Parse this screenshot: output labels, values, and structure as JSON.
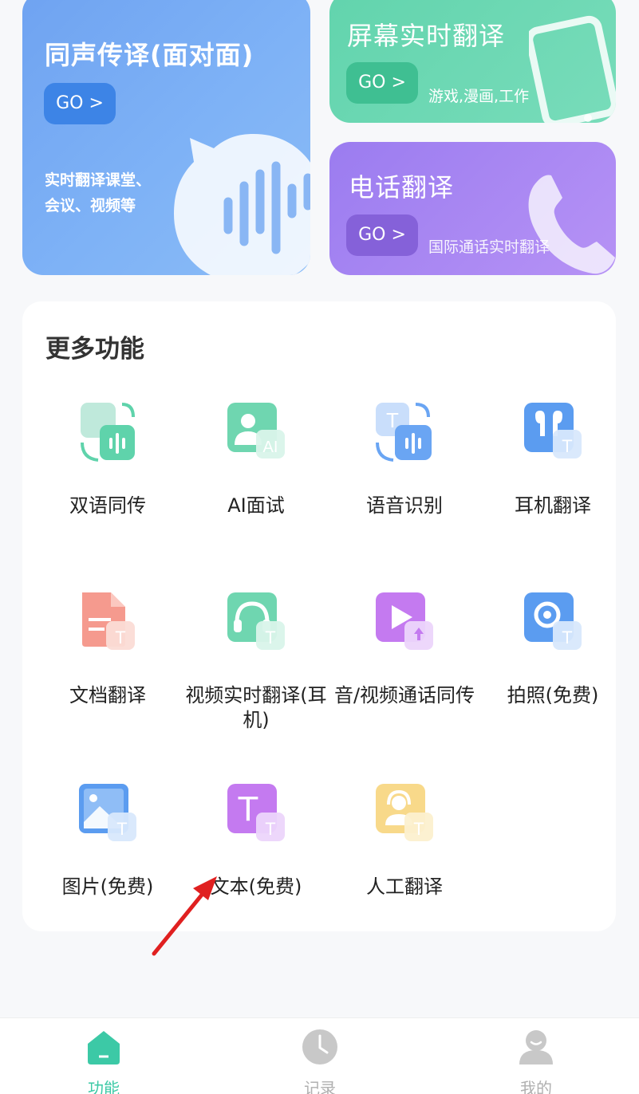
{
  "cards": {
    "simultaneous": {
      "title": "同声传译(面对面)",
      "go": "GO >",
      "desc_line1": "实时翻译课堂、",
      "desc_line2": "会议、视频等"
    },
    "screen": {
      "title": "屏幕实时翻译",
      "go": "GO >",
      "desc": "游戏,漫画,工作"
    },
    "phone": {
      "title": "电话翻译",
      "go": "GO >",
      "desc": "国际通话实时翻译"
    }
  },
  "more": {
    "title": "更多功能",
    "items": [
      {
        "label": "双语同传",
        "icon": "bilingual-icon"
      },
      {
        "label": "AI面试",
        "icon": "ai-interview-icon"
      },
      {
        "label": "语音识别",
        "icon": "speech-recognition-icon"
      },
      {
        "label": "耳机翻译",
        "icon": "earphone-translate-icon"
      },
      {
        "label": "文档翻译",
        "icon": "document-translate-icon"
      },
      {
        "label": "视频实时翻译(耳机)",
        "icon": "video-realtime-icon"
      },
      {
        "label": "音/视频通话同传",
        "icon": "av-call-icon"
      },
      {
        "label": "拍照(免费)",
        "icon": "photo-translate-icon"
      },
      {
        "label": "图片(免费)",
        "icon": "image-translate-icon"
      },
      {
        "label": "文本(免费)",
        "icon": "text-translate-icon"
      },
      {
        "label": "人工翻译",
        "icon": "human-translate-icon"
      }
    ]
  },
  "nav": {
    "items": [
      {
        "label": "功能",
        "icon": "home-icon",
        "active": true
      },
      {
        "label": "记录",
        "icon": "clock-icon",
        "active": false
      },
      {
        "label": "我的",
        "icon": "profile-icon",
        "active": false
      }
    ]
  },
  "colors": {
    "accent": "#3cc9a6",
    "card_blue": "#7eb2f6",
    "card_green": "#6fd8b4",
    "card_purple": "#a886f3",
    "annotation_arrow": "#e02020"
  }
}
